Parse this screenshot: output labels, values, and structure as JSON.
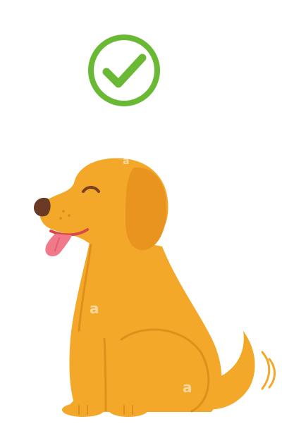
{
  "illustration": {
    "subject": "dog-sitting-happy-icon",
    "status_icon": "check-circle-icon",
    "status_color": "#6ab934",
    "fur_color": "#f3a829",
    "fur_shadow_color": "#e08f1b",
    "ear_color": "#e9941e",
    "nose_color": "#6b3a25",
    "tongue_color": "#f07a8a",
    "mouth_color": "#d84a4a"
  },
  "watermarks": [
    {
      "text": "a"
    },
    {
      "text": "a"
    },
    {
      "text": "a"
    }
  ]
}
